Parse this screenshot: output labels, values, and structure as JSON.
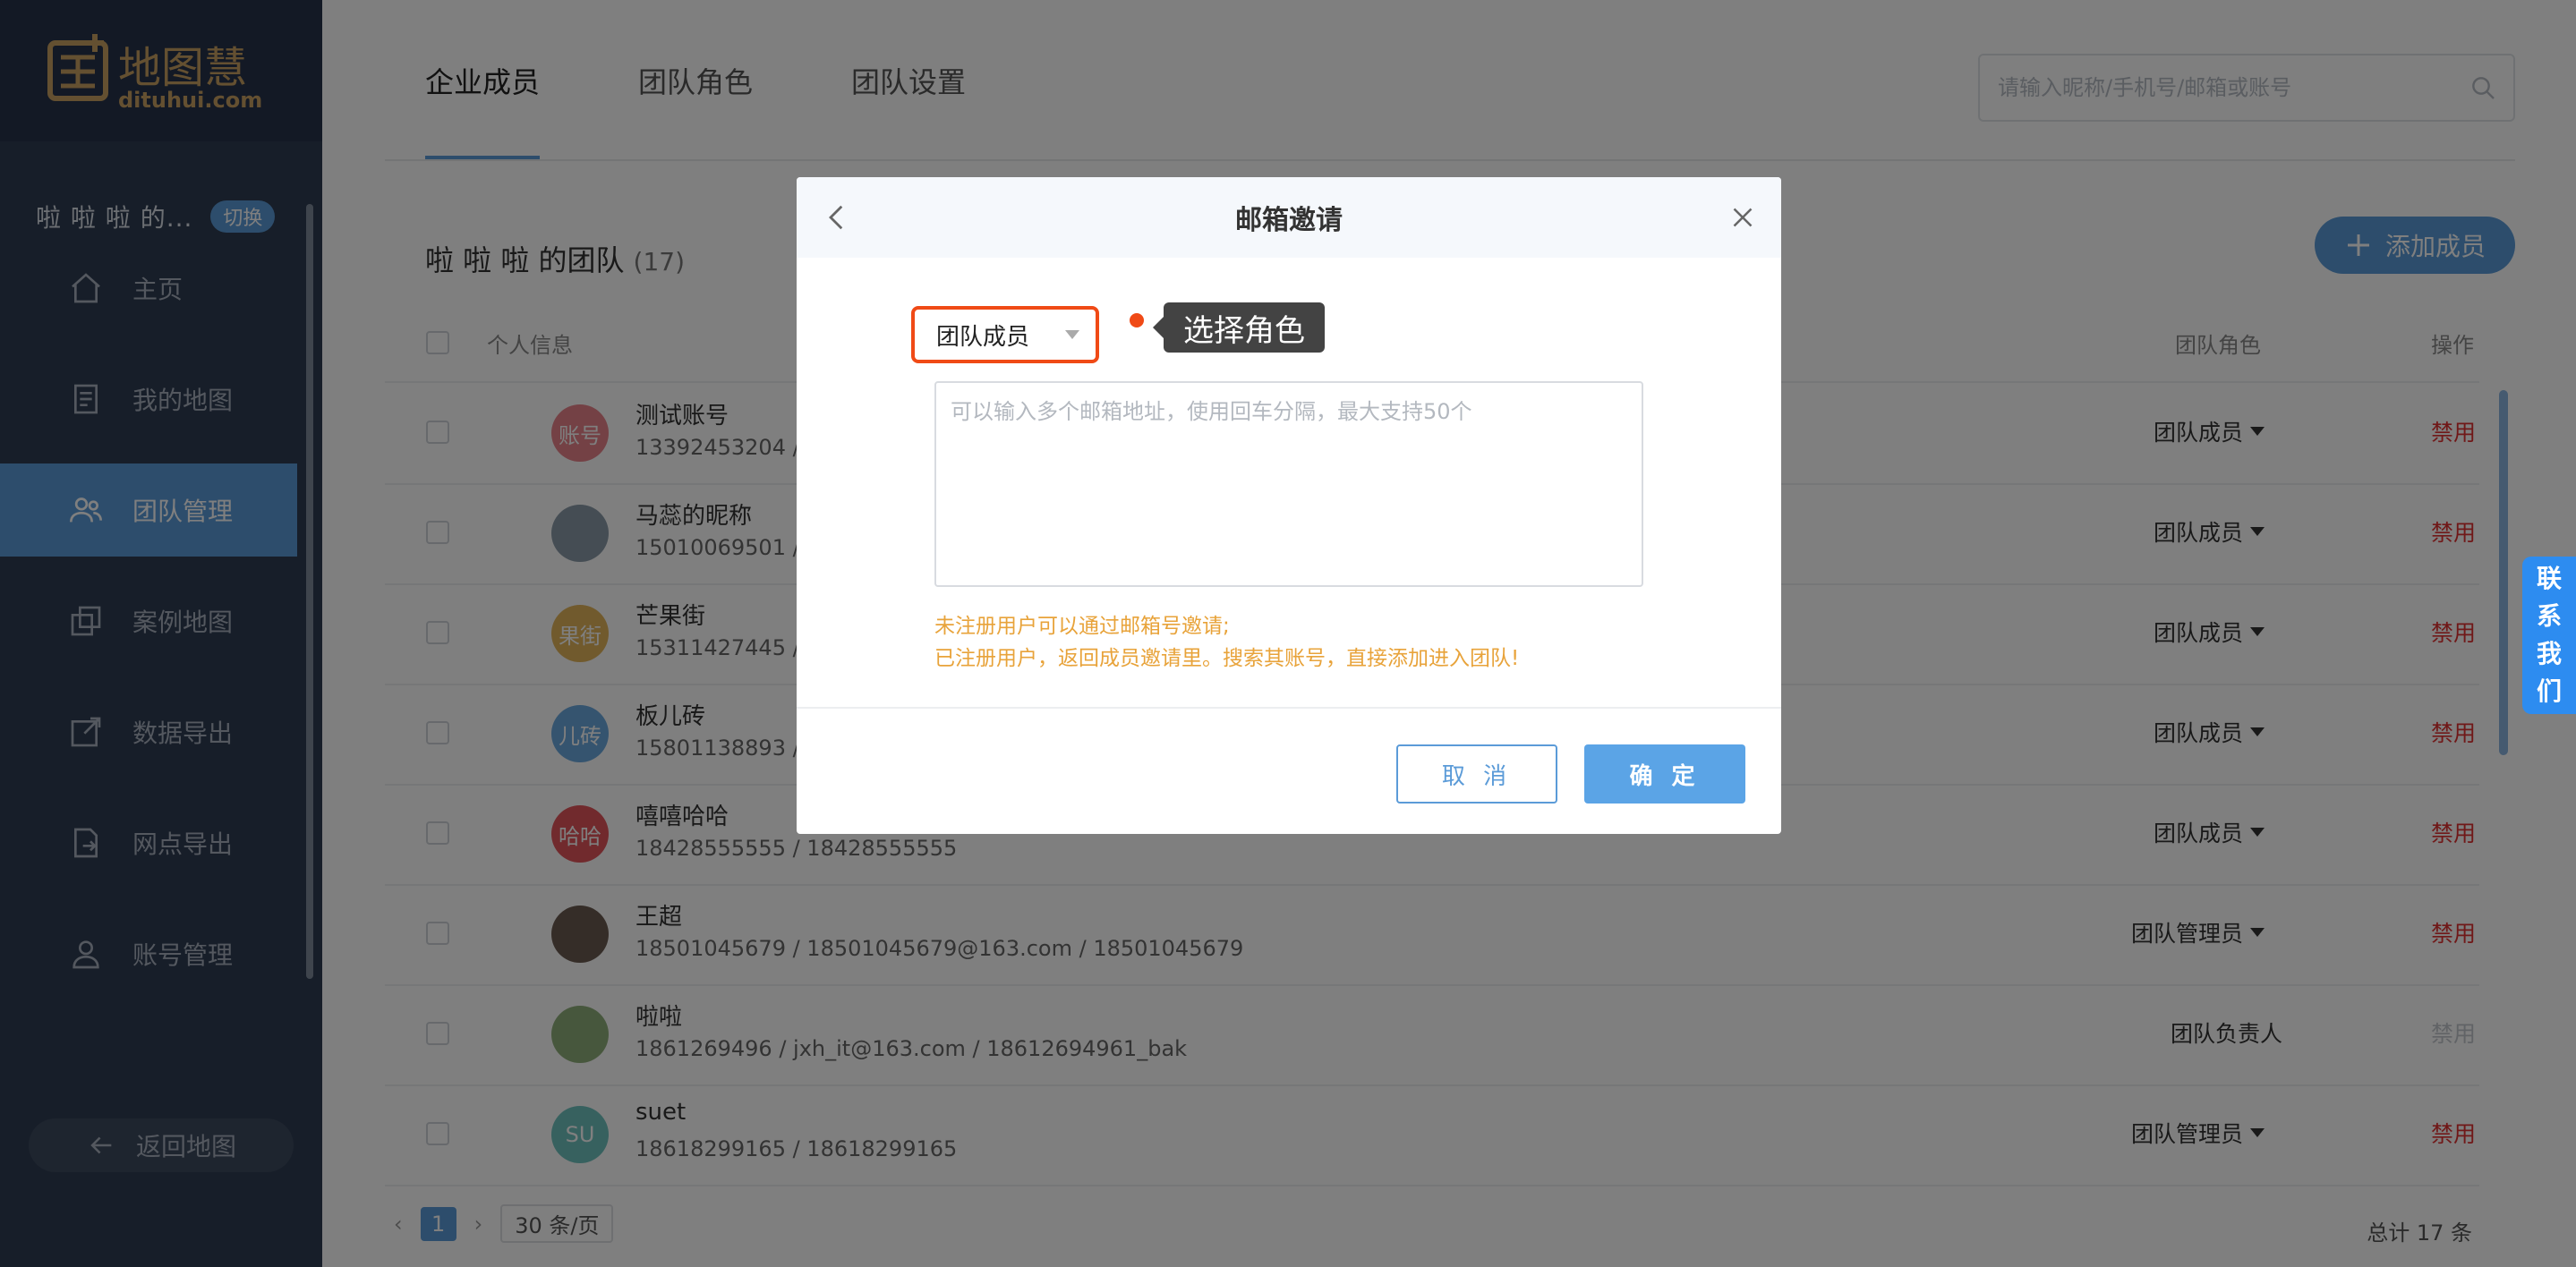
{
  "logo": {
    "cn": "地图慧",
    "en": "dituhui.com"
  },
  "sidebar": {
    "team_name": "啦 啦 啦 的...",
    "switch_label": "切换",
    "items": [
      {
        "label": "主页",
        "icon": "home-icon"
      },
      {
        "label": "我的地图",
        "icon": "document-icon"
      },
      {
        "label": "团队管理",
        "icon": "users-icon",
        "active": true
      },
      {
        "label": "案例地图",
        "icon": "copy-icon"
      },
      {
        "label": "数据导出",
        "icon": "export-icon"
      },
      {
        "label": "网点导出",
        "icon": "file-export-icon"
      },
      {
        "label": "账号管理",
        "icon": "user-icon"
      }
    ],
    "back_label": "返回地图"
  },
  "tabs": [
    "企业成员",
    "团队角色",
    "团队设置"
  ],
  "search": {
    "placeholder": "请输入昵称/手机号/邮箱或账号"
  },
  "team": {
    "title": "啦 啦 啦 的团队",
    "count": "(17)"
  },
  "add_member_label": "添加成员",
  "table": {
    "headers": {
      "info": "个人信息",
      "role": "团队角色",
      "op": "操作"
    },
    "rows": [
      {
        "avatar_text": "账号",
        "avatar_color": "#e8838a",
        "name": "测试账号",
        "info": "13392453204 / 133924",
        "role": "团队成员",
        "op": "禁用"
      },
      {
        "avatar_text": "",
        "avatar_color": "#8a9ba8",
        "name": "马蕊的昵称",
        "info": "15010069501 / 150100",
        "role": "团队成员",
        "op": "禁用"
      },
      {
        "avatar_text": "果街",
        "avatar_color": "#e2b45a",
        "name": "芒果街",
        "info": "15311427445 / 153114",
        "role": "团队成员",
        "op": "禁用"
      },
      {
        "avatar_text": "儿砖",
        "avatar_color": "#6aa8de",
        "name": "板儿砖",
        "info": "15801138893 / 158011",
        "role": "团队成员",
        "op": "禁用"
      },
      {
        "avatar_text": "哈哈",
        "avatar_color": "#e2545a",
        "name": "嘻嘻哈哈",
        "info": "18428555555 / 18428555555",
        "role": "团队成员",
        "op": "禁用"
      },
      {
        "avatar_text": "",
        "avatar_color": "#6a5a50",
        "name": "王超",
        "info": "18501045679 / 18501045679@163.com / 18501045679",
        "role": "团队管理员",
        "op": "禁用"
      },
      {
        "avatar_text": "",
        "avatar_color": "#8fae7a",
        "name": "啦啦",
        "info": "1861269496 / jxh_it@163.com / 18612694961_bak",
        "role": "团队负责人",
        "op": "禁用"
      },
      {
        "avatar_text": "SU",
        "avatar_color": "#6ec3bf",
        "name": "suet",
        "info": "18618299165 / 18618299165",
        "role": "团队管理员",
        "op": "禁用"
      }
    ]
  },
  "pager": {
    "page": "1",
    "page_size": "30 条/页",
    "total": "总计 17 条"
  },
  "contact": [
    "联",
    "系",
    "我",
    "们"
  ],
  "modal": {
    "title": "邮箱邀请",
    "role_selected": "团队成员",
    "tooltip": "选择角色",
    "placeholder": "可以输入多个邮箱地址，使用回车分隔，最大支持50个",
    "hint1": "未注册用户可以通过邮箱号邀请;",
    "hint2": "已注册用户，返回成员邀请里。搜索其账号，直接添加进入团队!",
    "cancel": "取 消",
    "ok": "确 定"
  },
  "colors": {
    "accent": "#5b9bd8",
    "danger": "#e03131",
    "highlight": "#f04a16",
    "sidebar": "#2f3d52",
    "hint": "#e8a33a"
  }
}
